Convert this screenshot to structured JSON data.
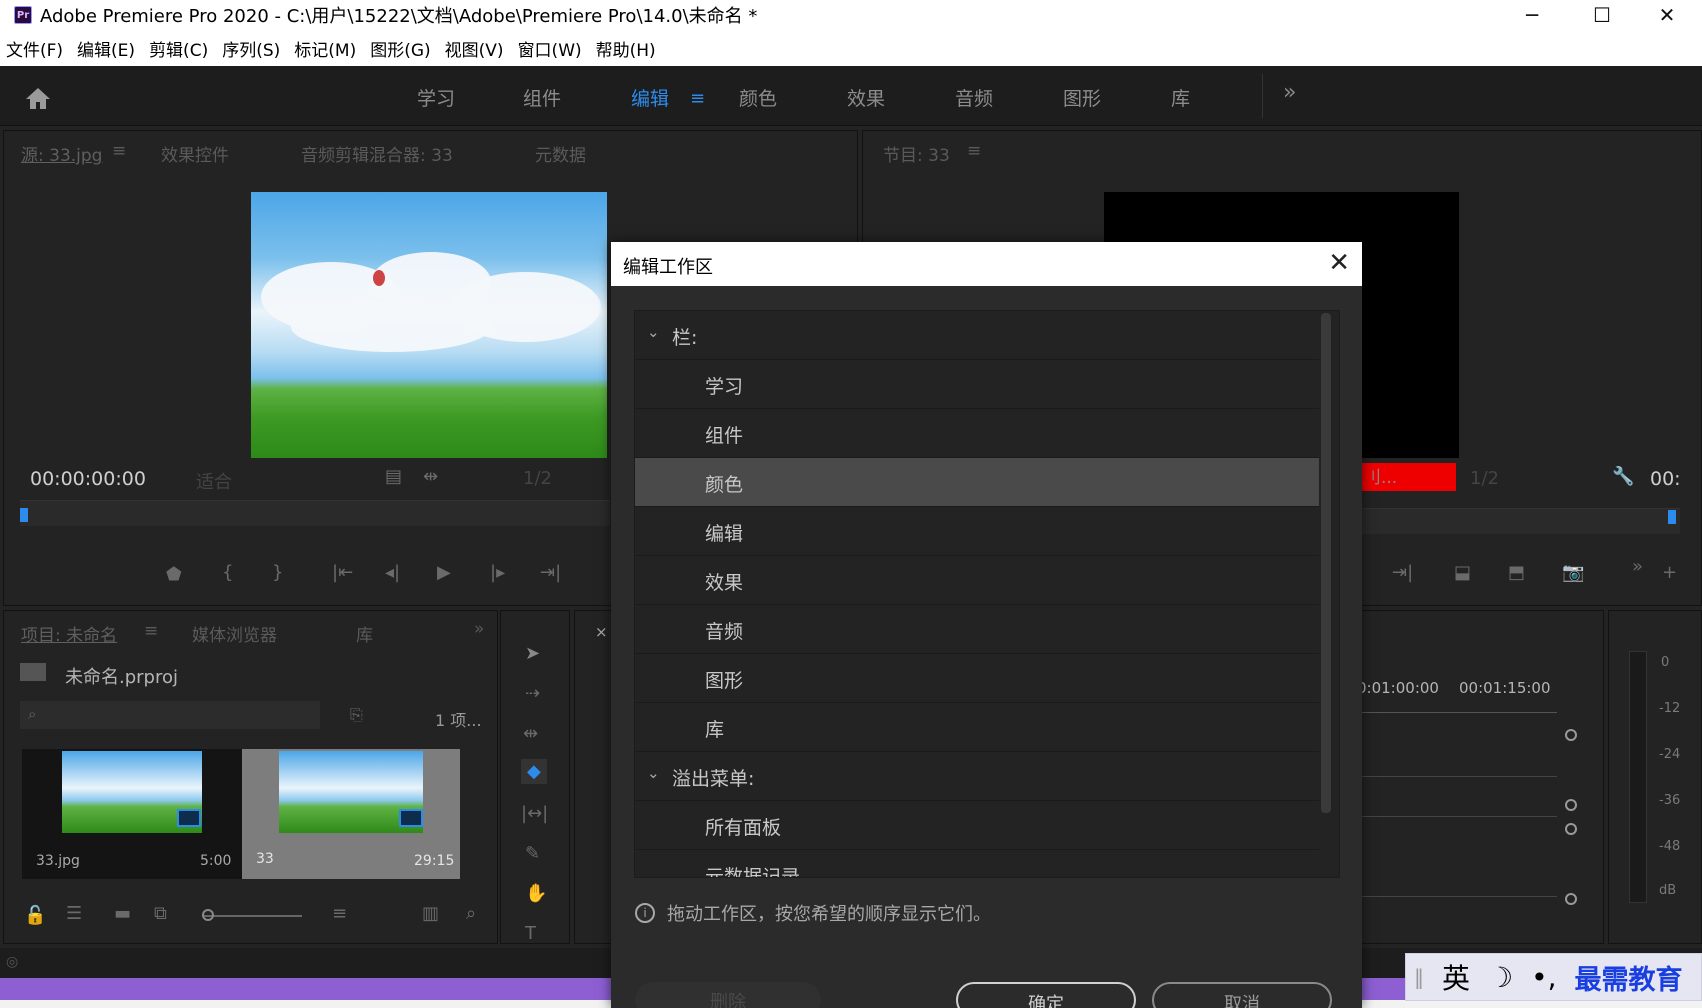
{
  "window": {
    "app_icon": "Pr",
    "title": "Adobe Premiere Pro 2020 - C:\\用户\\15222\\文档\\Adobe\\Premiere Pro\\14.0\\未命名 *",
    "minimize": "─",
    "maximize": "☐",
    "close": "✕"
  },
  "menu": [
    "文件(F)",
    "编辑(E)",
    "剪辑(C)",
    "序列(S)",
    "标记(M)",
    "图形(G)",
    "视图(V)",
    "窗口(W)",
    "帮助(H)"
  ],
  "workspaces": {
    "tabs": [
      "学习",
      "组件",
      "编辑",
      "颜色",
      "效果",
      "音频",
      "图形",
      "库"
    ],
    "active": "编辑",
    "menu_icon": "≡",
    "more": "»"
  },
  "source_panel": {
    "tabs": [
      "源: 33.jpg",
      "效果控件",
      "音频剪辑混合器: 33",
      "元数据"
    ],
    "tab_menu": "≡",
    "timecode": "00:00:00:00",
    "fit": "适合",
    "resolution": "1/2"
  },
  "program_panel": {
    "tab": "节目: 33",
    "tab_menu": "≡",
    "resolution": "1/2",
    "timecode_partial": "00:",
    "red_label": "刂..."
  },
  "project_panel": {
    "tabs": [
      "项目: 未命名",
      "媒体浏览器",
      "库"
    ],
    "tab_menu": "≡",
    "more": "»",
    "file": "未命名.prproj",
    "count": "1 项...",
    "items": [
      {
        "name": "33.jpg",
        "duration": "5:00"
      },
      {
        "name": "33",
        "duration": "29:15"
      }
    ]
  },
  "timeline": {
    "close": "×",
    "times": [
      "0:01:00:00",
      "00:01:15:00"
    ]
  },
  "audio_meter": {
    "labels": [
      "0",
      "-12",
      "-24",
      "-36",
      "-48",
      "dB"
    ]
  },
  "dialog": {
    "title": "编辑工作区",
    "close": "✕",
    "sections": [
      {
        "label": "栏:",
        "items": [
          "学习",
          "组件",
          "颜色",
          "编辑",
          "效果",
          "音频",
          "图形",
          "库"
        ]
      },
      {
        "label": "溢出菜单:",
        "items": [
          "所有面板",
          "元数据记录"
        ]
      }
    ],
    "selected": "颜色",
    "hint": "拖动工作区，按您希望的顺序显示它们。",
    "buttons": {
      "delete": "删除",
      "ok": "确定",
      "cancel": "取消"
    }
  },
  "ime": {
    "lang": "英",
    "moon": "☽",
    "punct": "•,",
    "brand": "最需教育"
  }
}
